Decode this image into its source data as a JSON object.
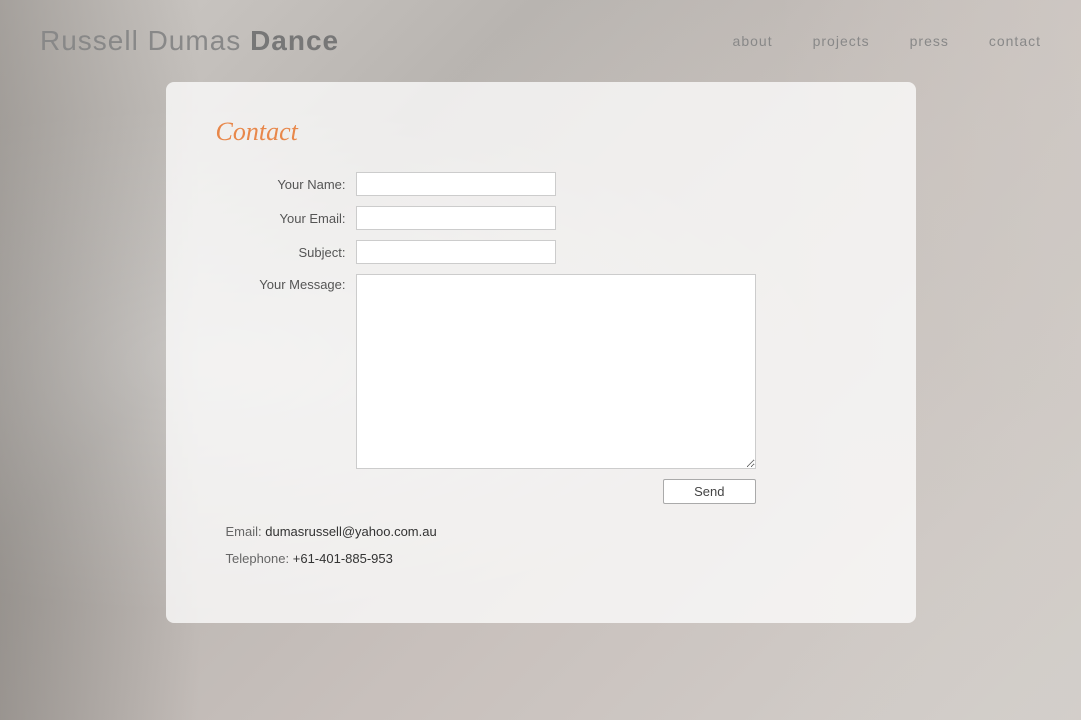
{
  "site": {
    "title_part1": "Russell Dumas",
    "title_part2": "Dance"
  },
  "nav": {
    "items": [
      {
        "label": "about",
        "href": "#"
      },
      {
        "label": "projects",
        "href": "#"
      },
      {
        "label": "press",
        "href": "#"
      },
      {
        "label": "contact",
        "href": "#"
      }
    ]
  },
  "contact": {
    "title": "Contact",
    "form": {
      "name_label": "Your Name:",
      "email_label": "Your Email:",
      "subject_label": "Subject:",
      "message_label": "Your Message:",
      "send_label": "Send"
    },
    "email_label": "Email:",
    "email_value": "dumasrussell@yahoo.com.au",
    "telephone_label": "Telephone:",
    "telephone_value": "+61-401-885-953"
  }
}
